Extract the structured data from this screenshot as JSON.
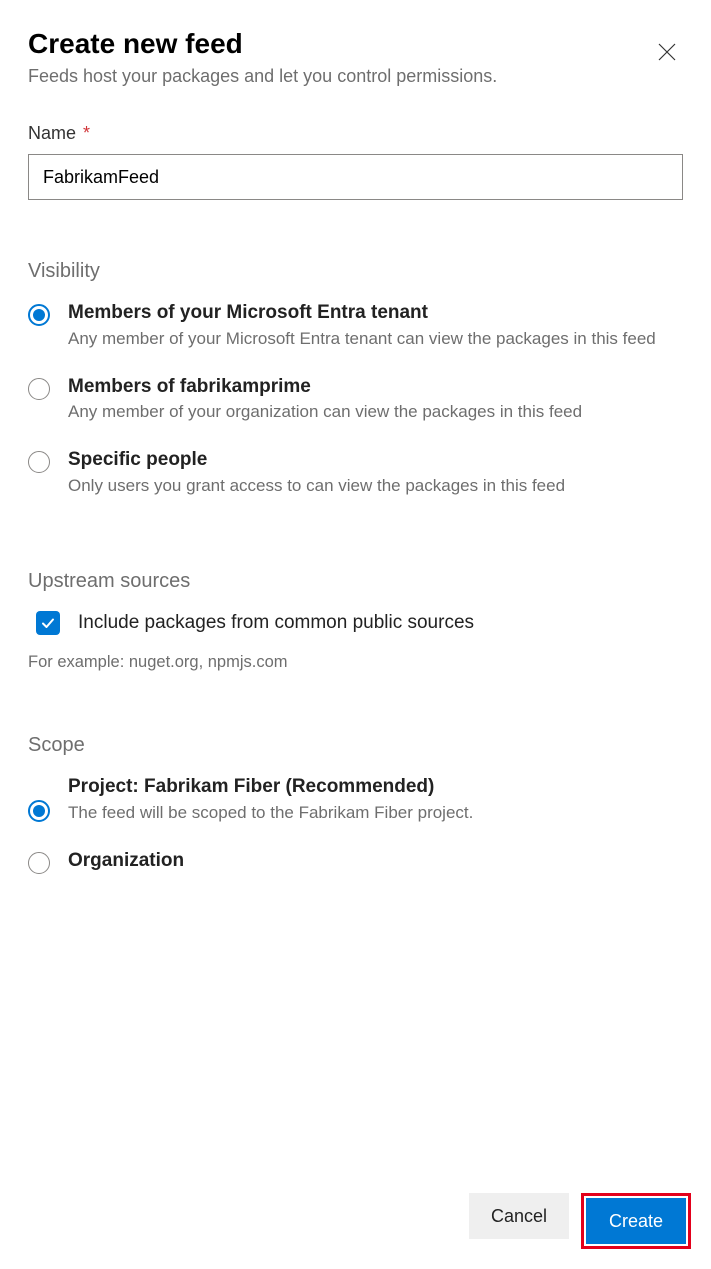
{
  "dialog": {
    "title": "Create new feed",
    "subtitle": "Feeds host your packages and let you control permissions."
  },
  "nameField": {
    "label": "Name",
    "required": "*",
    "value": "FabrikamFeed"
  },
  "visibility": {
    "header": "Visibility",
    "options": [
      {
        "title": "Members of your Microsoft Entra tenant",
        "sub": "Any member of your Microsoft Entra tenant can view the packages in this feed"
      },
      {
        "title": "Members of fabrikamprime",
        "sub": "Any member of your organization can view the packages in this feed"
      },
      {
        "title": "Specific people",
        "sub": "Only users you grant access to can view the packages in this feed"
      }
    ]
  },
  "upstream": {
    "header": "Upstream sources",
    "checkboxLabel": "Include packages from common public sources",
    "hint": "For example: nuget.org, npmjs.com"
  },
  "scope": {
    "header": "Scope",
    "options": [
      {
        "title": "Project: Fabrikam Fiber (Recommended)",
        "sub": "The feed will be scoped to the Fabrikam Fiber project."
      },
      {
        "title": "Organization",
        "sub": ""
      }
    ]
  },
  "footer": {
    "cancel": "Cancel",
    "create": "Create"
  }
}
